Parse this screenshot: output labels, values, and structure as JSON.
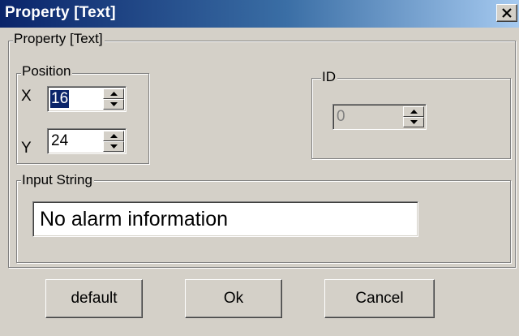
{
  "window": {
    "title": "Property  [Text]",
    "close_symbol": "×"
  },
  "main_group": {
    "label": "Property  [Text]"
  },
  "position_group": {
    "label": "Position",
    "x_label": "X",
    "x_value": "16",
    "y_label": "Y",
    "y_value": "24"
  },
  "id_group": {
    "label": "ID",
    "value": "0",
    "enabled": false
  },
  "input_group": {
    "label": "Input String",
    "value": "No alarm information"
  },
  "buttons": {
    "default_label": "default",
    "ok_label": "Ok",
    "cancel_label": "Cancel"
  },
  "colors": {
    "face": "#d4d0c8",
    "title_start": "#0a246a",
    "title_end": "#a6caf0",
    "selection": "#0a246a"
  },
  "icons": [
    "close-icon",
    "spin-up-arrow-icon",
    "spin-down-arrow-icon"
  ]
}
